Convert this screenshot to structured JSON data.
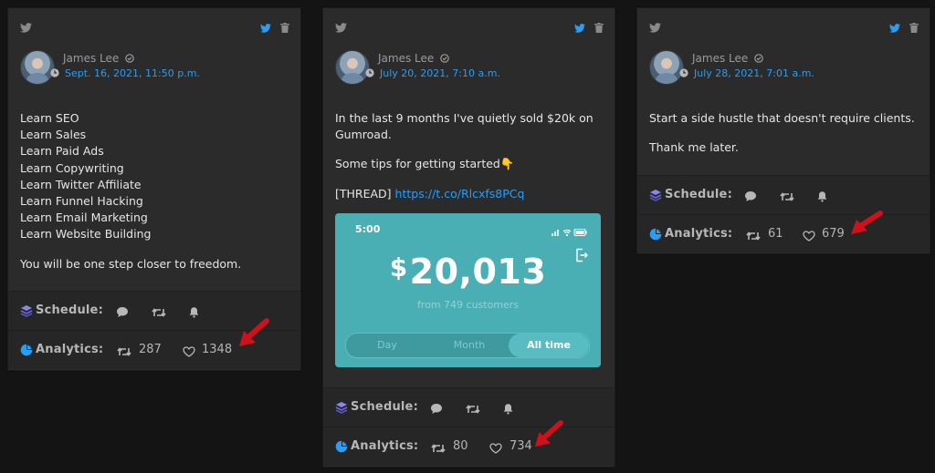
{
  "colors": {
    "twitter_blue": "#2a9df4",
    "card_bg": "#2b2b2b",
    "row_bg": "#262626",
    "arrow_red": "#d0101a",
    "teal": "#4aafb4"
  },
  "labels": {
    "schedule": "Schedule:",
    "analytics": "Analytics:"
  },
  "cards": [
    {
      "author": "James Lee",
      "date": "Sept. 16, 2021, 11:50 p.m.",
      "lines": [
        "Learn SEO",
        "Learn Sales",
        "Learn Paid Ads",
        "Learn Copywriting",
        "Learn Twitter Affiliate",
        "Learn Funnel Hacking",
        "Learn Email Marketing",
        "Learn Website Building"
      ],
      "closing": "You will be one step closer to freedom.",
      "retweets": "287",
      "likes": "1348"
    },
    {
      "author": "James Lee",
      "date": "July 20, 2021, 7:10 a.m.",
      "para1": "In the last 9 months I've quietly sold $20k on Gumroad.",
      "para2": "Some tips for getting started👇",
      "thread_prefix": "[THREAD] ",
      "thread_link": "https://t.co/Rlcxfs8PCq",
      "image": {
        "time": "5:00",
        "currency": "$",
        "amount": "20,013",
        "subtitle": "from 749 customers",
        "tabs": [
          "Day",
          "Month",
          "All time"
        ],
        "active_tab": "All time"
      },
      "retweets": "80",
      "likes": "734"
    },
    {
      "author": "James Lee",
      "date": "July 28, 2021, 7:01 a.m.",
      "para1": "Start a side hustle that doesn't require clients.",
      "para2": "Thank me later.",
      "retweets": "61",
      "likes": "679"
    }
  ]
}
